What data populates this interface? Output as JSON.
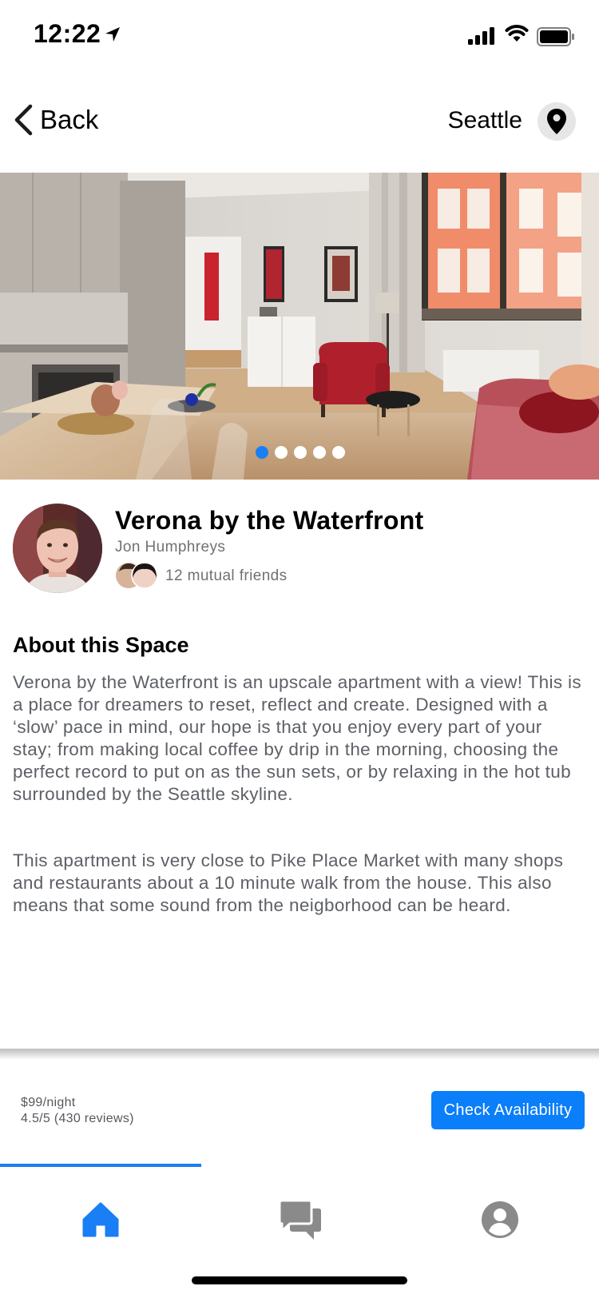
{
  "status_bar": {
    "time": "12:22"
  },
  "nav": {
    "back_label": "Back",
    "city": "Seattle"
  },
  "gallery": {
    "slide_count": 5,
    "active_index": 0
  },
  "listing": {
    "title": "Verona by the Waterfront",
    "host_name": "Jon Humphreys",
    "mutual_friends": "12 mutual friends"
  },
  "about": {
    "heading": "About this Space",
    "paragraph_1": "Verona by the Waterfront is an upscale apartment with a view! This is a place for dreamers to reset, reflect and create. Designed with a ‘slow’ pace in mind, our hope is that you enjoy every part of your stay; from making local coffee by drip in the morning, choosing the perfect record to put on as the sun sets, or by relaxing in the hot tub surrounded by the Seattle skyline.",
    "paragraph_2": "This apartment is very close to Pike Place Market with many shops and restaurants about a 10 minute walk from the house. This also means that some sound from the neigborhood can be heard."
  },
  "booking": {
    "price": "$99/night",
    "rating": "4.5/5 (430 reviews)",
    "cta_label": "Check Availability"
  },
  "tabs": [
    {
      "name": "home",
      "icon": "home-icon",
      "active": true
    },
    {
      "name": "messages",
      "icon": "chat-icon",
      "active": false
    },
    {
      "name": "profile",
      "icon": "user-icon",
      "active": false
    }
  ],
  "colors": {
    "accent": "#0b7ef9",
    "inactive_icon": "#8a8a8a",
    "body_text": "#5d6066"
  }
}
